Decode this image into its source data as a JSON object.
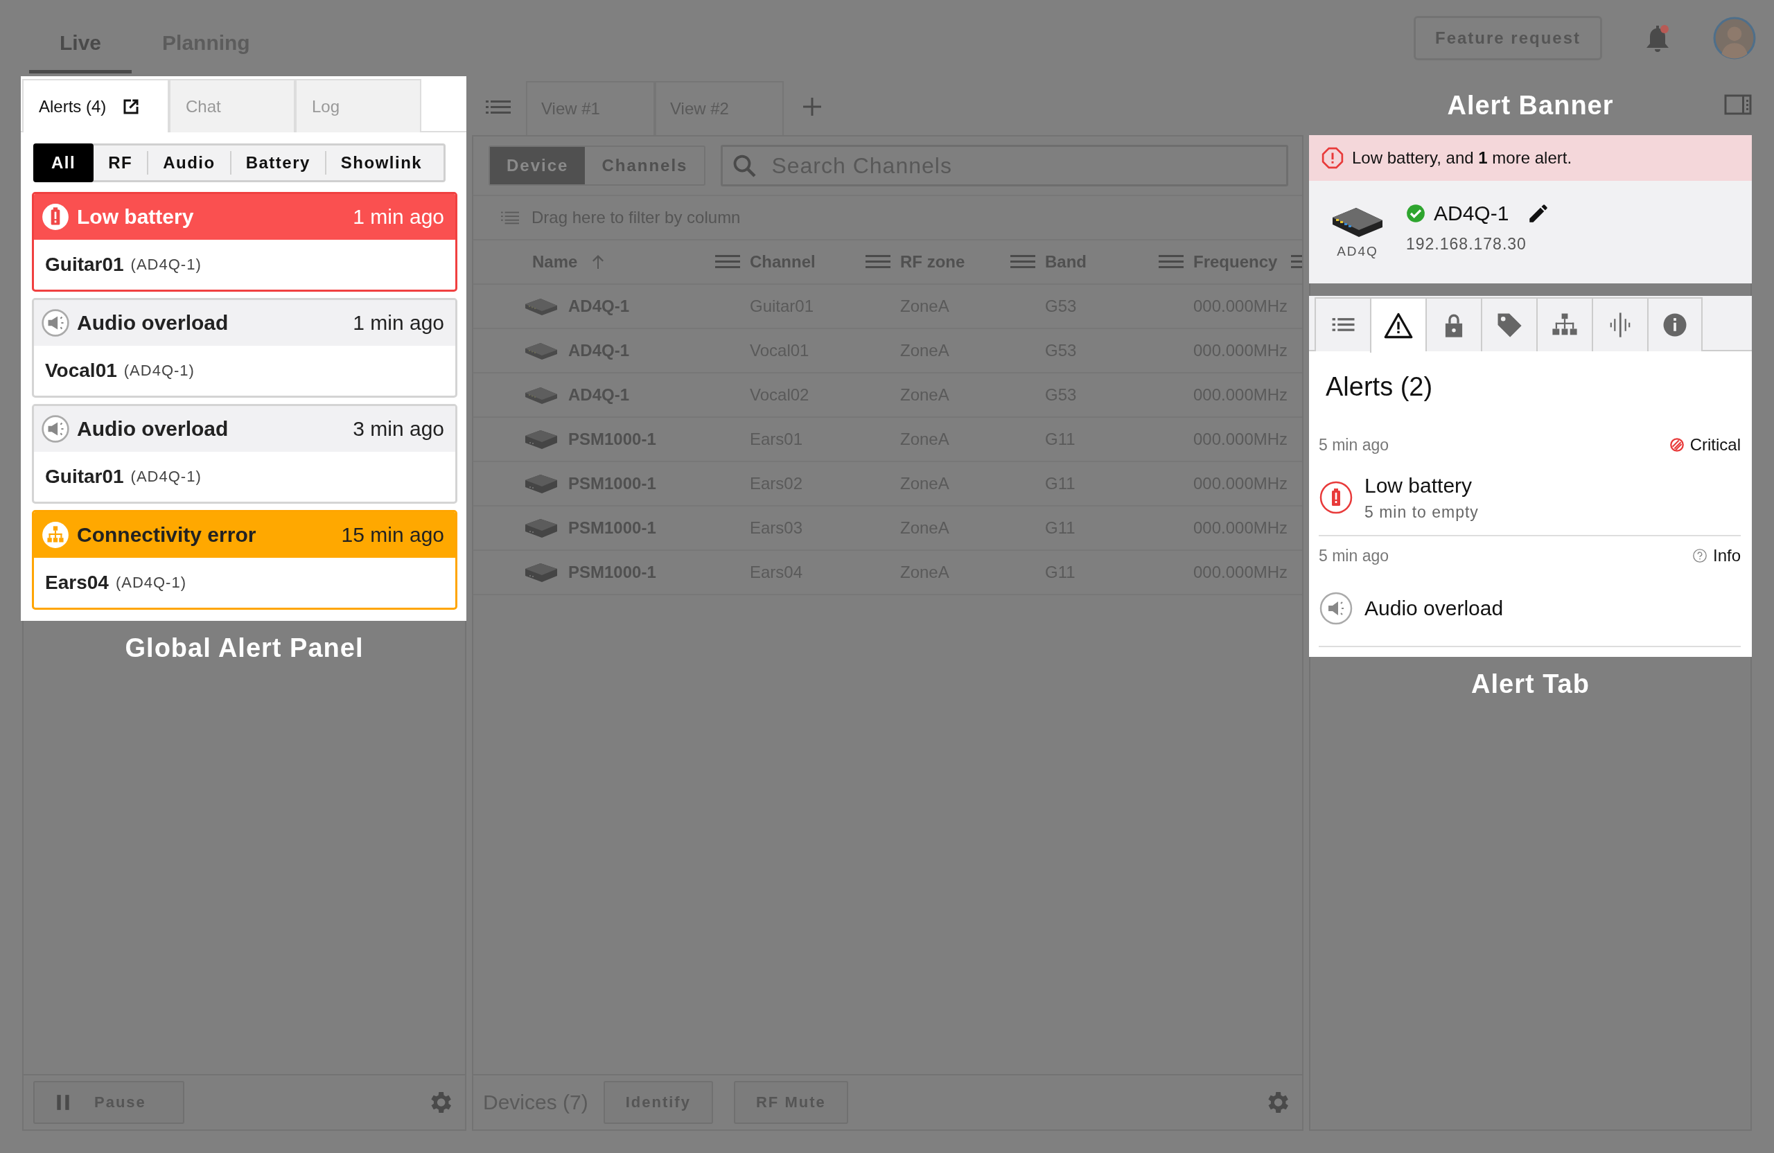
{
  "top_nav": {
    "tabs": [
      {
        "label": "Live",
        "selected": true
      },
      {
        "label": "Planning",
        "selected": false
      }
    ],
    "feature_request_button": "Feature request",
    "notifications": {
      "unread": true
    }
  },
  "alert_panel": {
    "tabs": [
      {
        "label": "Alerts (4)",
        "selected": true,
        "popout": true
      },
      {
        "label": "Chat",
        "selected": false,
        "popout": false
      },
      {
        "label": "Log",
        "selected": false,
        "popout": false
      }
    ],
    "filters": [
      {
        "label": "All",
        "selected": true
      },
      {
        "label": "RF",
        "selected": false
      },
      {
        "label": "Audio",
        "selected": false
      },
      {
        "label": "Battery",
        "selected": false
      },
      {
        "label": "Showlink",
        "selected": false
      }
    ],
    "alerts": [
      {
        "kind": "battery",
        "title": "Low battery",
        "time": "1 min ago",
        "channel": "Guitar01",
        "device": "(AD4Q-1)"
      },
      {
        "kind": "audio",
        "title": "Audio overload",
        "time": "1 min ago",
        "channel": "Vocal01",
        "device": "(AD4Q-1)"
      },
      {
        "kind": "audio",
        "title": "Audio overload",
        "time": "3 min ago",
        "channel": "Guitar01",
        "device": "(AD4Q-1)"
      },
      {
        "kind": "network",
        "title": "Connectivity error",
        "time": "15 min ago",
        "channel": "Ears04",
        "device": "(AD4Q-1)"
      }
    ],
    "caption": "Global Alert Panel",
    "pause_button": "Pause"
  },
  "devices": {
    "view_tabs": [
      "View #1",
      "View #2"
    ],
    "mode_toggle": [
      {
        "label": "Device",
        "selected": true
      },
      {
        "label": "Channels",
        "selected": false
      }
    ],
    "search": {
      "placeholder": "Search Channels"
    },
    "group_hint": "Drag here to filter by column",
    "columns": [
      {
        "label": "Name",
        "sorted": true
      },
      {
        "label": "Channel",
        "sorted": false
      },
      {
        "label": "RF zone",
        "sorted": false
      },
      {
        "label": "Band",
        "sorted": false
      },
      {
        "label": "Frequency",
        "sorted": false
      }
    ],
    "rows": [
      {
        "kind": "receiver",
        "name": "AD4Q-1",
        "channel": "Guitar01",
        "rf_zone": "ZoneA",
        "band": "G53",
        "frequency": "000.000MHz"
      },
      {
        "kind": "receiver",
        "name": "AD4Q-1",
        "channel": "Vocal01",
        "rf_zone": "ZoneA",
        "band": "G53",
        "frequency": "000.000MHz"
      },
      {
        "kind": "receiver",
        "name": "AD4Q-1",
        "channel": "Vocal02",
        "rf_zone": "ZoneA",
        "band": "G53",
        "frequency": "000.000MHz"
      },
      {
        "kind": "transmitter",
        "name": "PSM1000-1",
        "channel": "Ears01",
        "rf_zone": "ZoneA",
        "band": "G11",
        "frequency": "000.000MHz"
      },
      {
        "kind": "transmitter",
        "name": "PSM1000-1",
        "channel": "Ears02",
        "rf_zone": "ZoneA",
        "band": "G11",
        "frequency": "000.000MHz"
      },
      {
        "kind": "transmitter",
        "name": "PSM1000-1",
        "channel": "Ears03",
        "rf_zone": "ZoneA",
        "band": "G11",
        "frequency": "000.000MHz"
      },
      {
        "kind": "transmitter",
        "name": "PSM1000-1",
        "channel": "Ears04",
        "rf_zone": "ZoneA",
        "band": "G11",
        "frequency": "000.000MHz"
      }
    ],
    "count": "Devices (7)",
    "buttons": [
      "Identify",
      "RF Mute"
    ]
  },
  "alert_banner": {
    "caption": "Alert Banner",
    "message": "Low battery, and **1** more alert.",
    "device": {
      "model": "AD4Q",
      "name": "AD4Q-1",
      "online": true,
      "ip": "192.168.178.30"
    }
  },
  "alert_tab": {
    "caption": "Alert Tab",
    "tabs": [
      {
        "kind": "list",
        "selected": false
      },
      {
        "kind": "alerts",
        "selected": true
      },
      {
        "kind": "lock",
        "selected": false
      },
      {
        "kind": "tag",
        "selected": false
      },
      {
        "kind": "network",
        "selected": false
      },
      {
        "kind": "audio",
        "selected": false
      },
      {
        "kind": "info",
        "selected": false
      }
    ],
    "title": "Alerts (2)",
    "alerts": [
      {
        "time": "5 min ago",
        "critical": true,
        "severity_label": "Critical",
        "kind": "battery",
        "title": "Low battery",
        "detail": "5 min to empty"
      },
      {
        "time": "5 min ago",
        "critical": false,
        "severity_label": "Info",
        "kind": "audio",
        "title": "Audio overload"
      }
    ]
  }
}
